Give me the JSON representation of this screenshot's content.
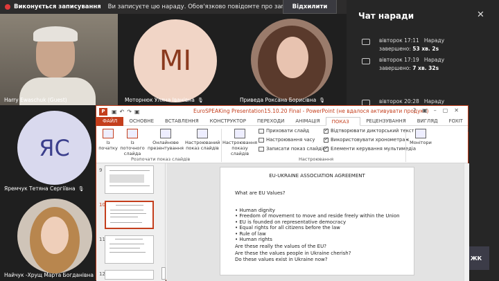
{
  "banner": {
    "status": "Виконується записування",
    "message": "Ви записуєте цю нараду. Обов'язково повідомте про запис",
    "dismiss": "Відхилити"
  },
  "participants": [
    {
      "name": "Harry Ewaschuk (Guest)"
    },
    {
      "name": "Моторнюк Уляна Іванівна",
      "initials": "MI"
    },
    {
      "name": "Приведа Роксана Борисівна"
    },
    {
      "name": "Яремчук Тетяна Сергіївна",
      "initials": "ЯС"
    },
    {
      "name": "Найчук -Хрущ Марта Богданівна"
    }
  ],
  "chat": {
    "title": "Чат наради",
    "messages": [
      {
        "time": "вівторок 17:11",
        "label": "Нараду",
        "ended": "завершено:",
        "duration": "53 хв. 2s"
      },
      {
        "time": "вівторок 17:19",
        "label": "Нараду",
        "ended": "завершено:",
        "duration": "7 хв. 32s"
      },
      {
        "time": "вівторок 20:28",
        "label": "Нараду"
      }
    ],
    "side_button": "ЖК"
  },
  "ppt": {
    "title": "EuroSPEAKing Presentation15.10.20 Final -  PowerPoint (не вдалося активувати продукт)",
    "tabs": [
      "ФАЙЛ",
      "ОСНОВНЕ",
      "ВСТАВЛЕННЯ",
      "КОНСТРУКТОР",
      "ПЕРЕХОДИ",
      "АНІМАЦІЯ",
      "ПОКАЗ СЛАЙДІВ",
      "РЕЦЕНЗУВАННЯ",
      "ВИГЛЯД",
      "FOXIT READER"
    ],
    "ribbon": {
      "from_start": "Із початку",
      "from_current_1": "Із поточного",
      "from_current_2": "слайда",
      "online_1": "Онлайнове",
      "online_2": "презентування",
      "custom_1": "Настроюваний",
      "custom_2": "показ слайдів",
      "group1": "Розпочати показ слайдів",
      "setup_1": "Настроювання",
      "setup_2": "показу слайдів",
      "hide": "Приховати слайд",
      "rehearse": "Настроювання часу",
      "record": "Записати показ слайдів",
      "narrations": "Відтворювати дикторський текст",
      "timings": "Використовувати хронометраж",
      "media": "Елементи керування мультимедіа",
      "group2": "Настроювання",
      "monitors": "Монітори"
    },
    "thumb_numbers": [
      "9",
      "10",
      "11",
      "12"
    ],
    "slide": {
      "title": "EU-UKRAINE ASSOCIATION AGREEMENT",
      "question": "What are EU Values?",
      "bullets": [
        "Human dignity",
        "Freedom of movement to move and reside freely within the Union",
        "EU is founded on representative democracy",
        "Equal rights for all citizens before the law",
        "Rule of law",
        "Human rights"
      ],
      "questions": [
        "Are these really the values of the EU?",
        "Are these the values people in Ukraine cherish?",
        "Do these values exist in Ukraine now?"
      ]
    }
  },
  "colors": {
    "accent": "#c43e1c",
    "background": "#1f1f1f"
  }
}
